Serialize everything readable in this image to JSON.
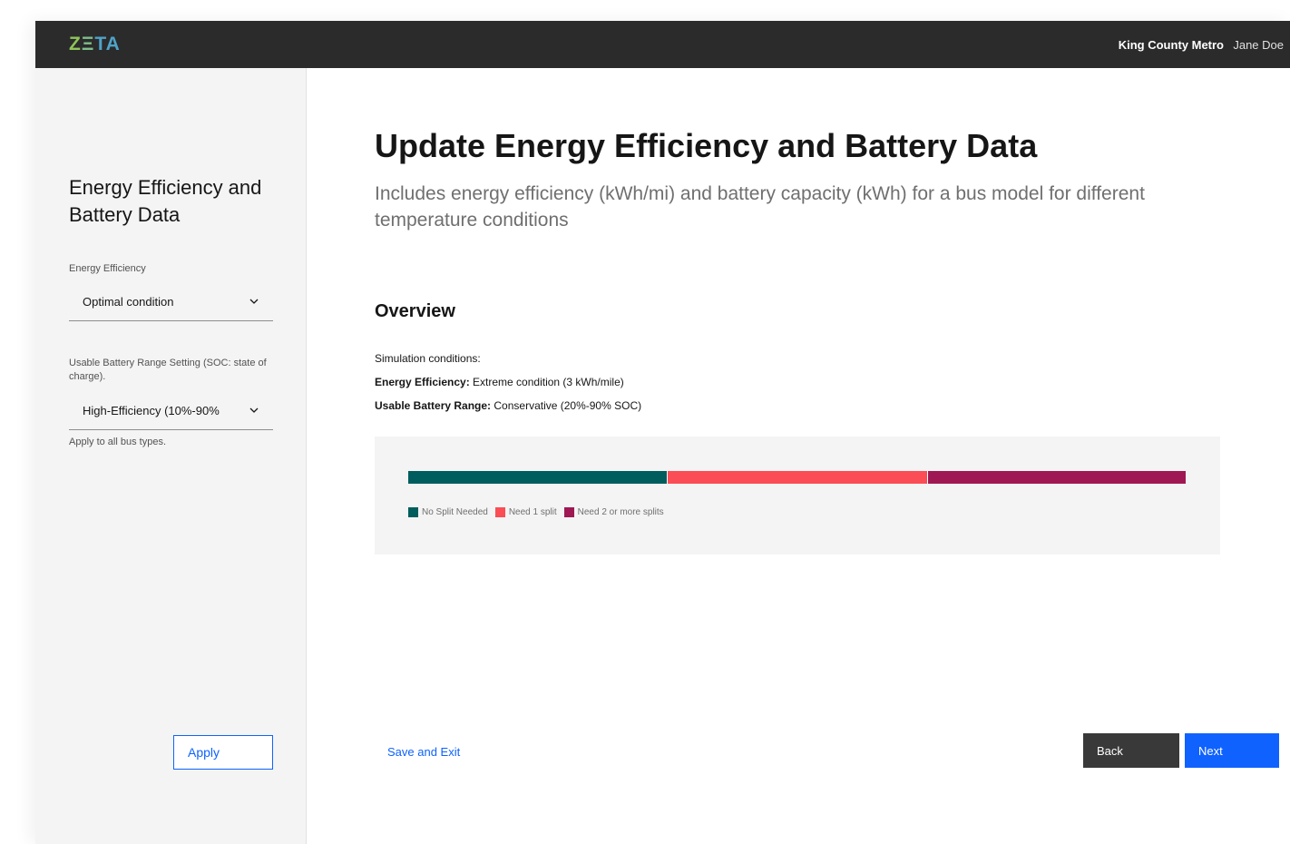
{
  "header": {
    "logo": {
      "z": "Z",
      "e": "Ξ",
      "ta": "TA"
    },
    "org": "King County Metro",
    "user": "Jane Doe"
  },
  "sidebar": {
    "title": "Energy Efficiency and Battery Data",
    "energy_label": "Energy Efficiency",
    "energy_value": "Optimal condition",
    "battery_label": "Usable Battery Range Setting (SOC: state of charge).",
    "battery_value": "High-Efficiency (10%-90%",
    "helper": "Apply to all bus types.",
    "apply_label": "Apply"
  },
  "main": {
    "title": "Update Energy Efficiency and Battery Data",
    "subtitle": "Includes energy efficiency (kWh/mi) and battery capacity (kWh) for a bus model for different temperature conditions",
    "overview_title": "Overview",
    "conditions_label": "Simulation conditions:",
    "energy_key": "Energy Efficiency:",
    "energy_val": " Extreme condition (3 kWh/mile)",
    "battery_key": "Usable Battery Range:",
    "battery_val": " Conservative (20%-90% SOC)"
  },
  "chart_data": {
    "type": "bar",
    "categories": [
      "No Split Needed",
      "Need 1 split",
      "Need 2 or more splits"
    ],
    "values": [
      33.3,
      33.4,
      33.3
    ],
    "colors": [
      "#005d5d",
      "#fa4d56",
      "#9f1853"
    ]
  },
  "footer": {
    "save_exit": "Save and Exit",
    "back": "Back",
    "next": "Next"
  },
  "icons": {
    "dropdown": "chevron-down-icon"
  }
}
